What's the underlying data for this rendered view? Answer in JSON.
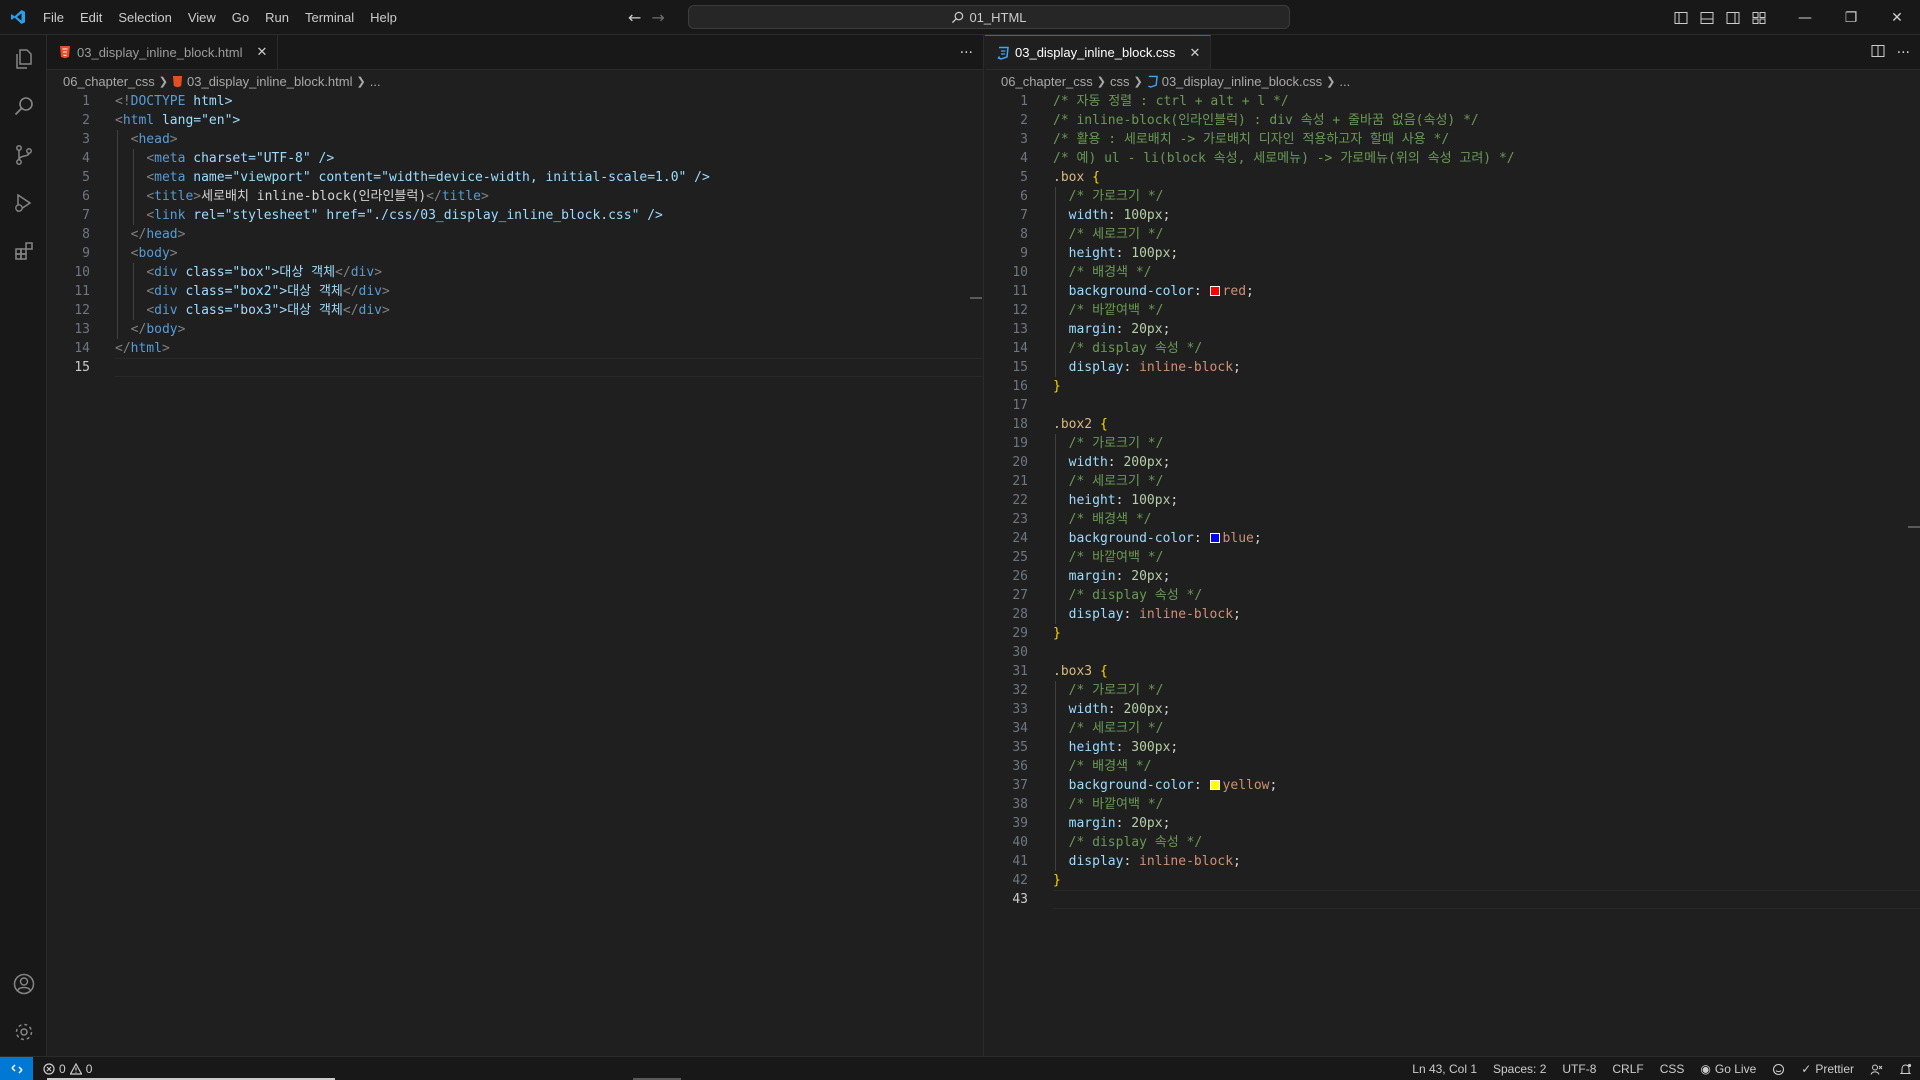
{
  "menu": [
    "File",
    "Edit",
    "Selection",
    "View",
    "Go",
    "Run",
    "Terminal",
    "Help"
  ],
  "command_center": {
    "label": "01_HTML"
  },
  "left_editor": {
    "tab": {
      "filename": "03_display_inline_block.html",
      "close": "✕"
    },
    "more_actions": "···",
    "breadcrumb": [
      "06_chapter_css",
      "03_display_inline_block.html",
      "..."
    ],
    "current_line": 15
  },
  "right_editor": {
    "tab": {
      "filename": "03_display_inline_block.css",
      "close": "✕"
    },
    "breadcrumb": [
      "06_chapter_css",
      "css",
      "03_display_inline_block.css",
      "..."
    ],
    "current_line": 43
  },
  "html_code": [
    "<!DOCTYPE html>",
    "<html lang=\"en\">",
    "  <head>",
    "    <meta charset=\"UTF-8\" />",
    "    <meta name=\"viewport\" content=\"width=device-width, initial-scale=1.0\" />",
    "    <title>세로배치 inline-block(인라인블럭)</title>",
    "    <link rel=\"stylesheet\" href=\"./css/03_display_inline_block.css\" />",
    "  </head>",
    "  <body>",
    "    <div class=\"box\">대상 객체</div>",
    "    <div class=\"box2\">대상 객체</div>",
    "    <div class=\"box3\">대상 객체</div>",
    "  </body>",
    "</html>",
    ""
  ],
  "css_code": [
    "/* 자동 정렬 : ctrl + alt + l */",
    "/* inline-block(인라인블럭) : div 속성 + 줄바꿈 없음(속성) */",
    "/* 활용 : 세로배치 -> 가로배치 디자인 적용하고자 할때 사용 */",
    "/* 예) ul - li(block 속성, 세로메뉴) -> 가로메뉴(위의 속성 고려) */",
    ".box {",
    "  /* 가로크기 */",
    "  width: 100px;",
    "  /* 세로크기 */",
    "  height: 100px;",
    "  /* 배경색 */",
    "  background-color: red;",
    "  /* 바깥여백 */",
    "  margin: 20px;",
    "  /* display 속성 */",
    "  display: inline-block;",
    "}",
    "",
    ".box2 {",
    "  /* 가로크기 */",
    "  width: 200px;",
    "  /* 세로크기 */",
    "  height: 100px;",
    "  /* 배경색 */",
    "  background-color: blue;",
    "  /* 바깥여백 */",
    "  margin: 20px;",
    "  /* display 속성 */",
    "  display: inline-block;",
    "}",
    "",
    ".box3 {",
    "  /* 가로크기 */",
    "  width: 200px;",
    "  /* 세로크기 */",
    "  height: 300px;",
    "  /* 배경색 */",
    "  background-color: yellow;",
    "  /* 바깥여백 */",
    "  margin: 20px;",
    "  /* display 속성 */",
    "  display: inline-block;",
    "}",
    ""
  ],
  "colors": {
    "red": "#ff0000",
    "blue": "#0000ff",
    "yellow": "#ffff00",
    "accent": "#0078d4"
  },
  "statusbar": {
    "errors": "0",
    "warnings": "0",
    "position": "Ln 43, Col 1",
    "spaces": "Spaces: 2",
    "encoding": "UTF-8",
    "eol": "CRLF",
    "language": "CSS",
    "go_live": "Go Live",
    "prettier": "Prettier"
  },
  "icons": [
    "vscode-logo-icon",
    "explorer-icon",
    "search-icon",
    "source-control-icon",
    "run-debug-icon",
    "extensions-icon",
    "accounts-icon",
    "manage-gear-icon",
    "remote-icon",
    "error-icon",
    "warning-icon",
    "broadcast-icon",
    "bell-icon"
  ]
}
